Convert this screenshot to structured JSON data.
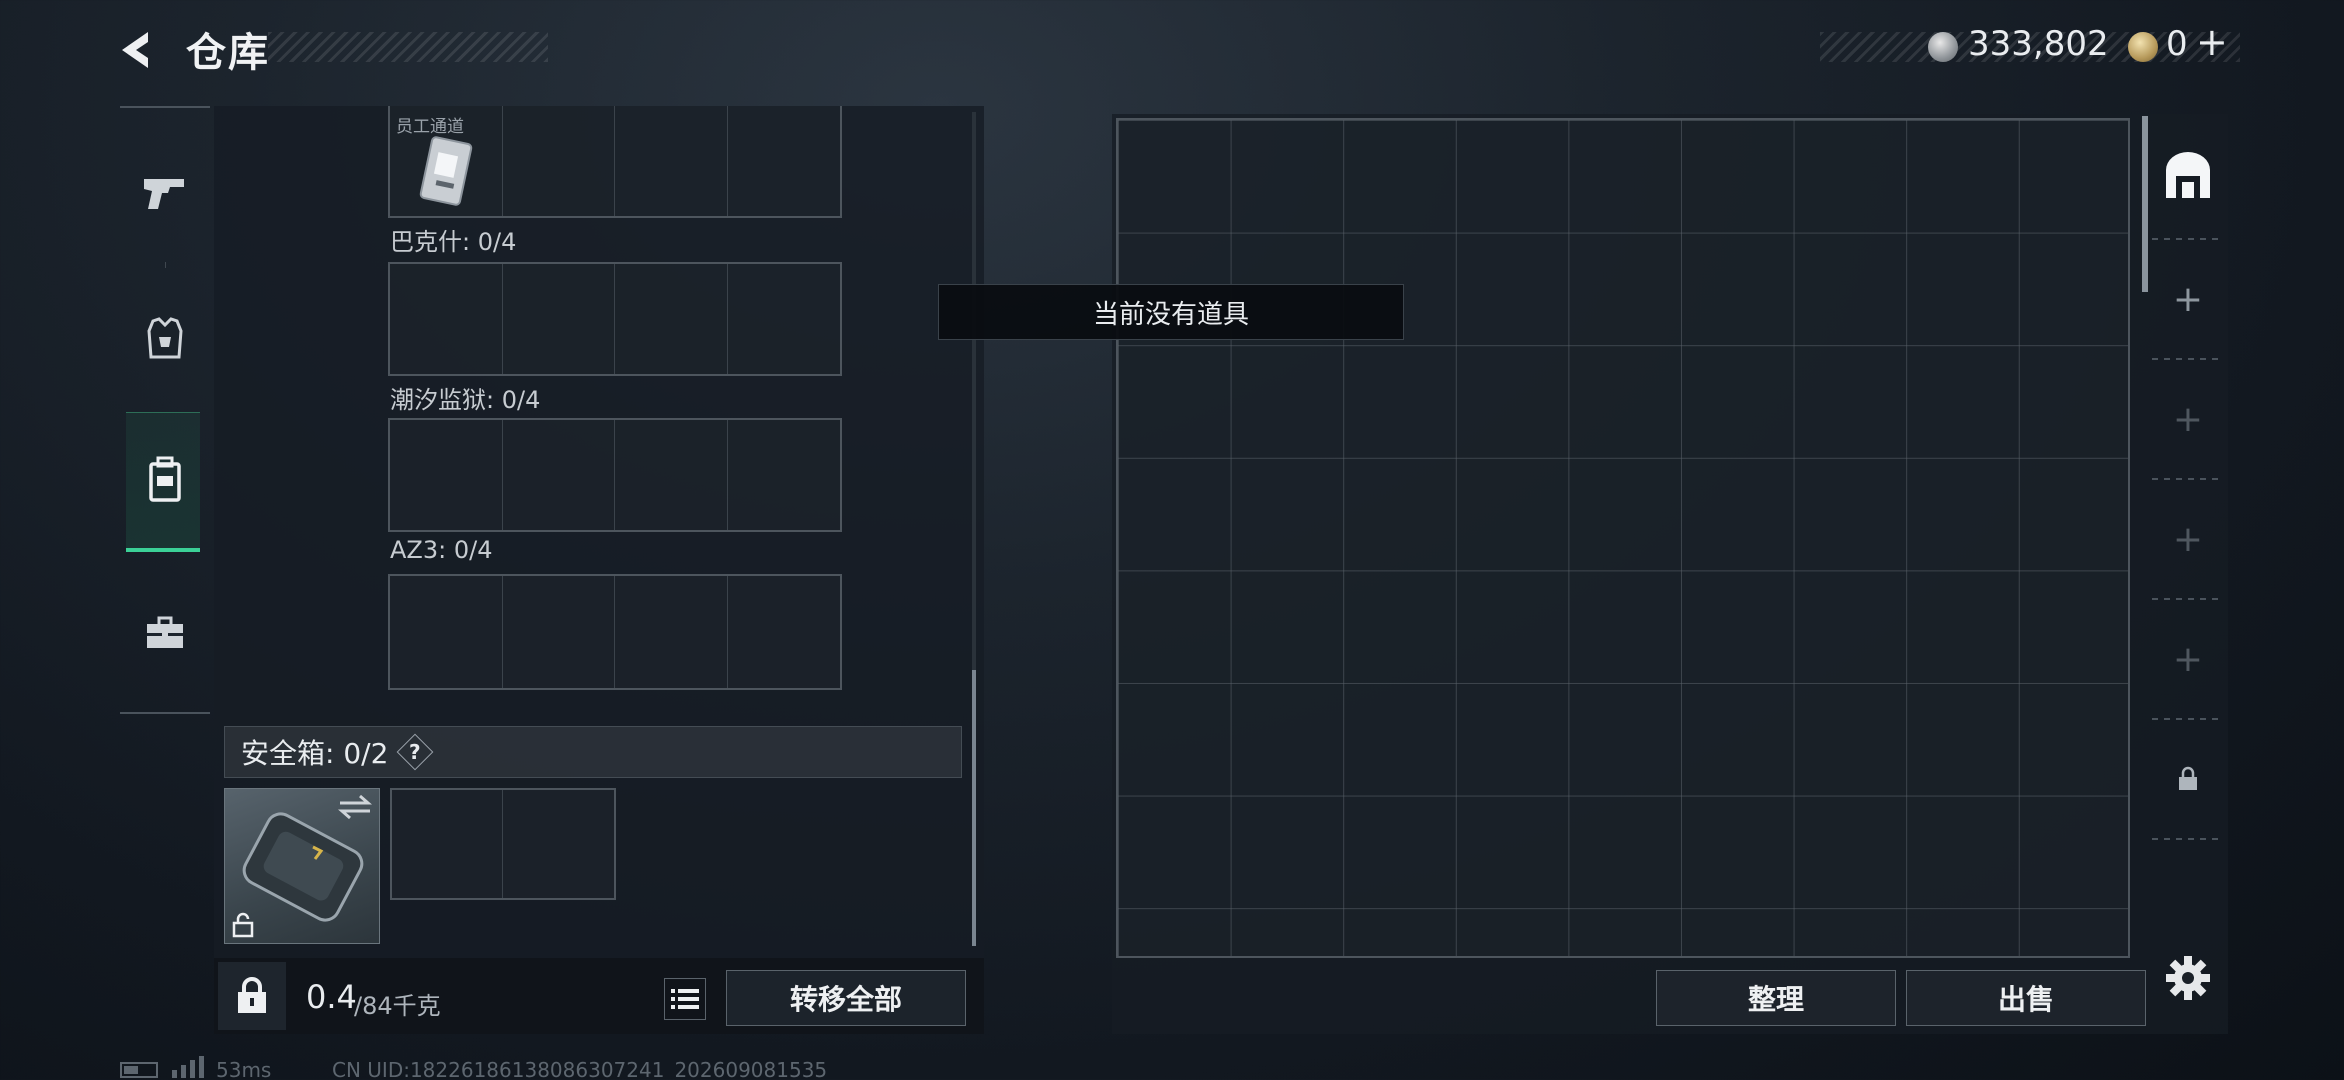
{
  "header": {
    "title": "仓库",
    "coins": "333,802",
    "tickets": "0",
    "tickets_plus": "+"
  },
  "rail": {
    "items": [
      {
        "icon": "pistol-icon"
      },
      {
        "icon": "armor-vest-icon"
      },
      {
        "icon": "backpack-icon",
        "active": true
      },
      {
        "icon": "toolbox-icon"
      }
    ]
  },
  "keys": {
    "keycard_label": "员工通道",
    "groups": [
      {
        "label": "巴克什: 0/4"
      },
      {
        "label": "潮汐监狱: 0/4"
      },
      {
        "label": "AZ3: 0/4"
      }
    ]
  },
  "safebox": {
    "label": "安全箱: 0/2",
    "help": "?"
  },
  "footer": {
    "weight": "0.4",
    "capacity": "/84千克",
    "transfer_label": "转移全部"
  },
  "warehouse": {
    "empty_tip": "当前没有道具",
    "sort_label": "整理",
    "sell_label": "出售"
  },
  "pages": {
    "slots": [
      {
        "icon": "warehouse-page-icon"
      },
      {
        "icon": "add-page-icon",
        "text": "+"
      },
      {
        "icon": "add-page-icon",
        "text": "+"
      },
      {
        "icon": "add-page-icon",
        "text": "+"
      },
      {
        "icon": "add-page-icon",
        "text": "+"
      },
      {
        "icon": "lock-icon"
      }
    ]
  },
  "status": {
    "ping": "53ms",
    "uid": "CN UID:18226186138086307241_202609081535"
  },
  "colors": {
    "accent": "#3bd197",
    "panel": "#161c24",
    "border": "#4d555d"
  }
}
